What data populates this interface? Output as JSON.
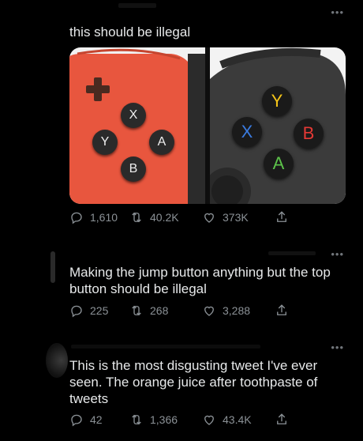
{
  "tweets": [
    {
      "text": "this should be illegal",
      "stats": {
        "replies": "1,610",
        "retweets": "40.2K",
        "likes": "373K"
      },
      "media": {
        "left": {
          "buttons": [
            "X",
            "Y",
            "A",
            "B"
          ],
          "color": "#e8563e"
        },
        "right": {
          "buttons": [
            "Y",
            "X",
            "B",
            "A"
          ],
          "color": "#3b3b3b"
        }
      }
    },
    {
      "text": "Making the jump button anything but the top button should be illegal",
      "stats": {
        "replies": "225",
        "retweets": "268",
        "likes": "3,288"
      }
    },
    {
      "text": "This is the most disgusting tweet I've ever seen. The orange juice after toothpaste of tweets",
      "stats": {
        "replies": "42",
        "retweets": "1,366",
        "likes": "43.4K"
      }
    }
  ],
  "colors": {
    "xbox_y": "#f5c518",
    "xbox_x": "#3a7be0",
    "xbox_b": "#e53935",
    "xbox_a": "#5cc34a"
  }
}
